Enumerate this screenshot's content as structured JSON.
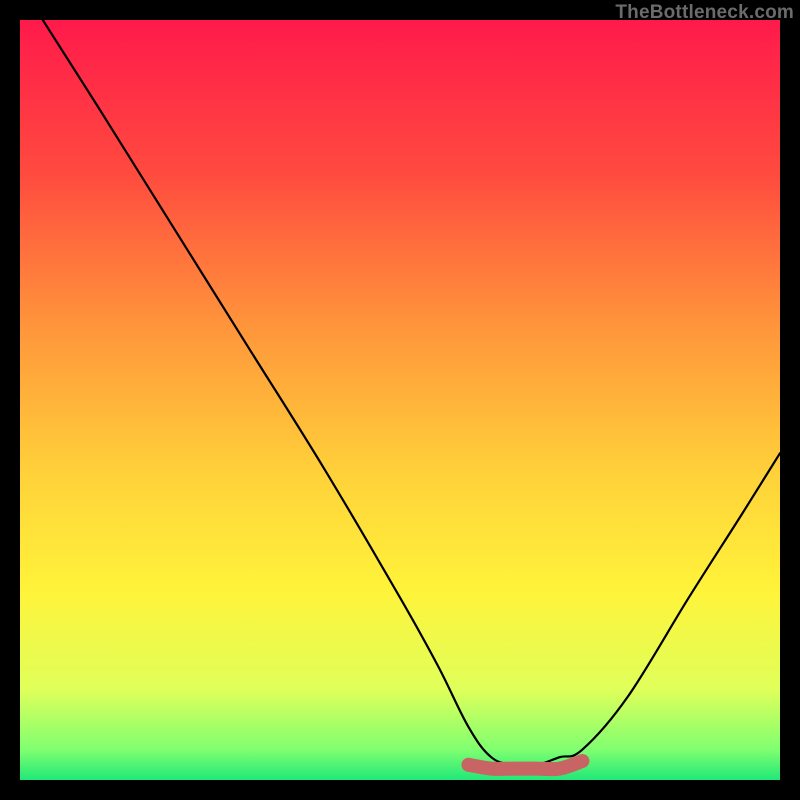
{
  "watermark": "TheBottleneck.com",
  "chart_data": {
    "type": "line",
    "title": "",
    "xlabel": "",
    "ylabel": "",
    "xlim": [
      0,
      100
    ],
    "ylim": [
      0,
      100
    ],
    "grid": false,
    "series": [
      {
        "name": "bottleneck-curve",
        "x": [
          3,
          10,
          20,
          30,
          40,
          50,
          55,
          59,
          62,
          65,
          68,
          71,
          74,
          80,
          88,
          95,
          100
        ],
        "y": [
          100,
          89,
          73,
          57,
          41,
          24,
          15,
          7,
          3,
          2,
          2,
          3,
          4,
          11,
          24,
          35,
          43
        ],
        "color": "#000000"
      },
      {
        "name": "optimal-range-band",
        "x": [
          59,
          62,
          65,
          68,
          71,
          74
        ],
        "y": [
          2,
          1.5,
          1.5,
          1.5,
          1.5,
          2.5
        ],
        "color": "#c86464"
      }
    ],
    "background_gradient": {
      "stops": [
        {
          "pos": 0.0,
          "color": "#ff1a4b"
        },
        {
          "pos": 0.2,
          "color": "#ff4a3f"
        },
        {
          "pos": 0.4,
          "color": "#ff943b"
        },
        {
          "pos": 0.6,
          "color": "#ffd23a"
        },
        {
          "pos": 0.75,
          "color": "#fff33a"
        },
        {
          "pos": 0.88,
          "color": "#e0ff5a"
        },
        {
          "pos": 0.96,
          "color": "#80ff70"
        },
        {
          "pos": 1.0,
          "color": "#20e878"
        }
      ]
    }
  }
}
